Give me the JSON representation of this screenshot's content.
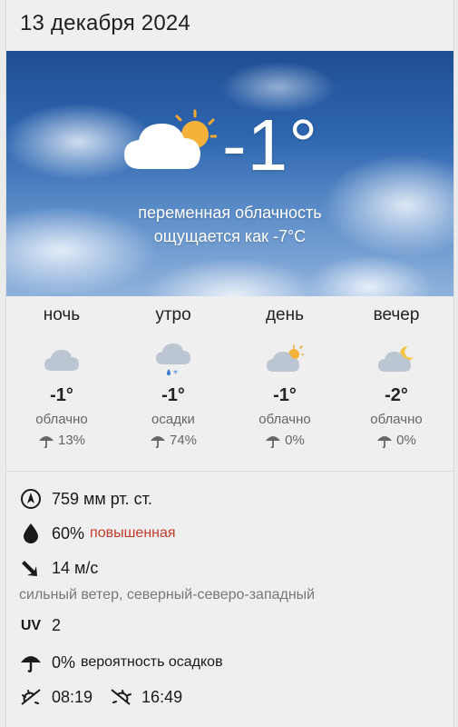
{
  "date": "13 декабря 2024",
  "current": {
    "temperature": "-1°",
    "condition": "переменная облачность",
    "feels_like": "ощущается как -7°C",
    "icon": "partly-cloudy-day-icon"
  },
  "periods": [
    {
      "name": "ночь",
      "temp": "-1°",
      "condition": "облачно",
      "precip": "13%",
      "icon": "cloud-icon"
    },
    {
      "name": "утро",
      "temp": "-1°",
      "condition": "осадки",
      "precip": "74%",
      "icon": "cloud-rain-snow-icon"
    },
    {
      "name": "день",
      "temp": "-1°",
      "condition": "облачно",
      "precip": "0%",
      "icon": "cloud-sun-icon"
    },
    {
      "name": "вечер",
      "temp": "-2°",
      "condition": "облачно",
      "precip": "0%",
      "icon": "cloud-moon-icon"
    }
  ],
  "details": {
    "pressure": "759 мм рт. ст.",
    "humidity": "60%",
    "humidity_level": "повышенная",
    "wind_speed": "14 м/с",
    "wind_description": "сильный ветер, северный-северо-западный",
    "uv_label": "UV",
    "uv_value": "2",
    "precip_chance": "0%",
    "precip_text": "вероятность осадков",
    "sunrise": "08:19",
    "sunset": "16:49"
  },
  "colors": {
    "humidity_level": "#c23a2a",
    "secondary_text": "#666666",
    "sun": "#f4b23a"
  }
}
